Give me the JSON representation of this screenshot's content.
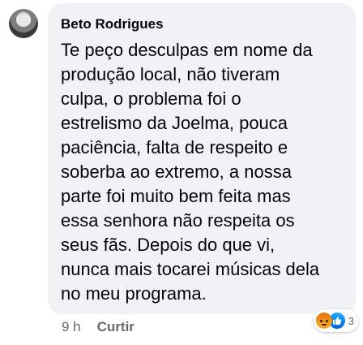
{
  "comment": {
    "author": "Beto Rodrigues",
    "text": "Te peço desculpas em nome da\nprodução local, não tiveram\nculpa, o problema foi o\nestrelismo da Joelma, pouca\npaciência, falta de respeito e\nsoberba ao extremo, a nossa\nparte foi muito bem feita mas\nessa senhora não respeita os\nseus fãs. Depois do que vi,\nnunca mais tocarei músicas dela\nno meu programa.",
    "timestamp": "9 h",
    "like_label": "Curtir",
    "reactions": {
      "icons": [
        "angry-icon",
        "like-icon"
      ],
      "count": "3"
    }
  },
  "colors": {
    "bubble_bg": "#f0f2f5",
    "text": "#050505",
    "meta_text": "#65676b",
    "like_blue": "#0062df",
    "angry_orange": "#e9710f"
  }
}
